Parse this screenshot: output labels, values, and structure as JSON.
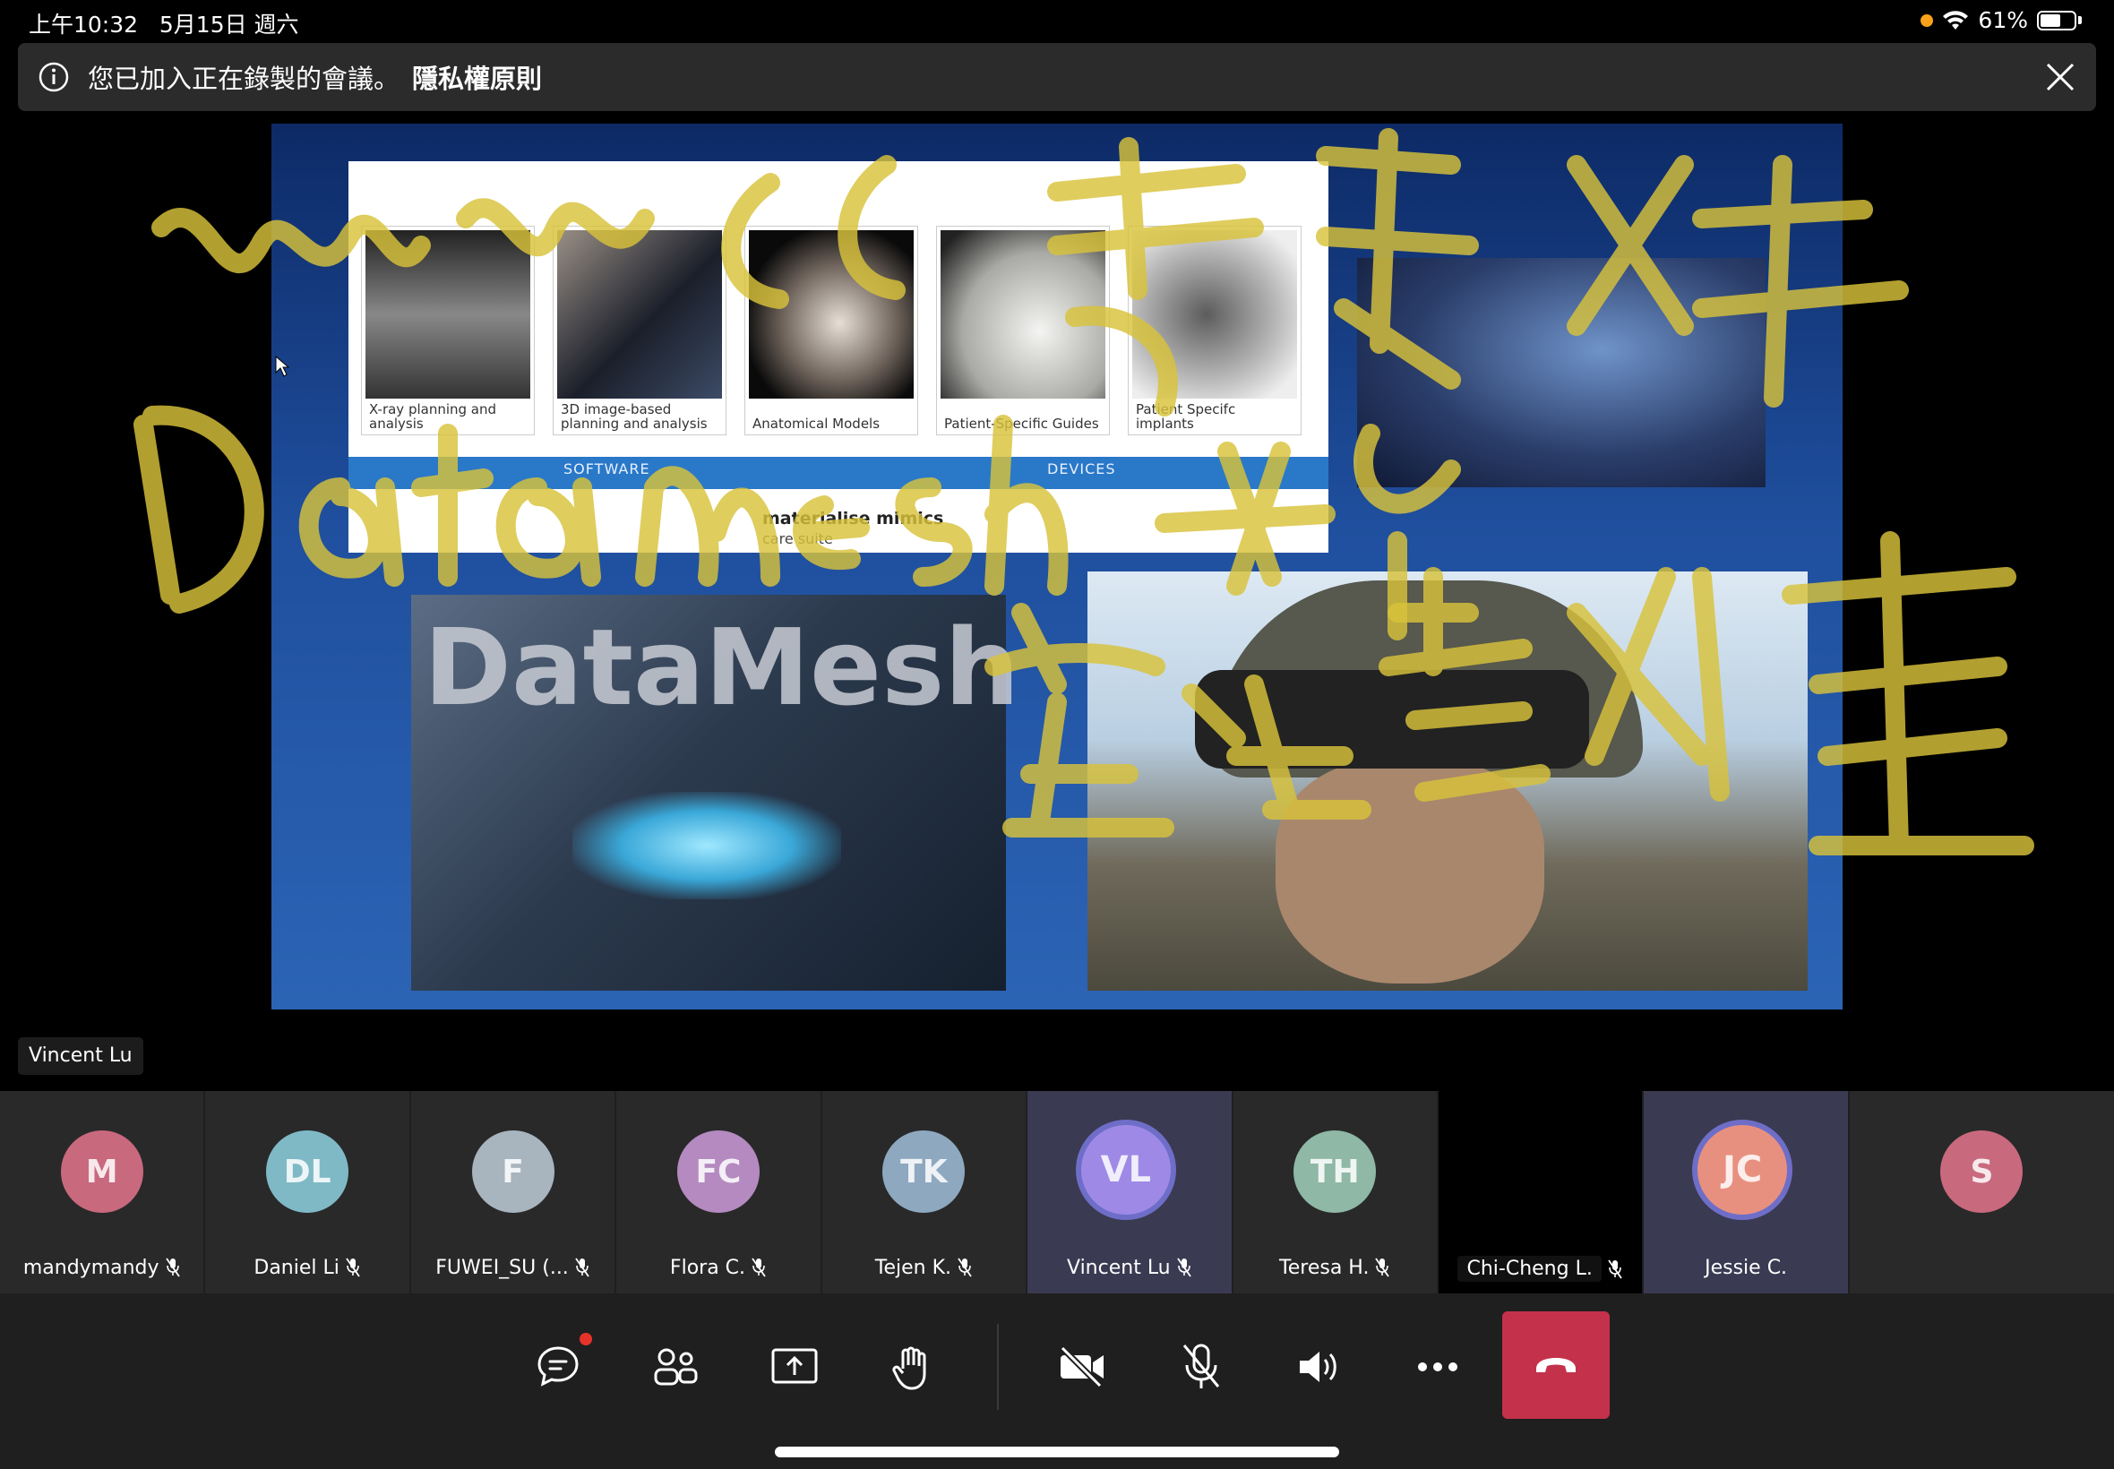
{
  "status_bar": {
    "time": "上午10:32",
    "date": "5月15日 週六",
    "battery": "61%",
    "battery_level": 0.61
  },
  "banner": {
    "text": "您已加入正在錄製的會議。",
    "link": "隱私權原則"
  },
  "slide": {
    "tiles": [
      "X-ray planning and analysis",
      "3D image-based planning and analysis",
      "Anatomical Models",
      "Patient-Specific Guides",
      "Patient Specifc implants"
    ],
    "stripe_left": "SOFTWARE",
    "stripe_right": "DEVICES",
    "brand": "materialise mimics",
    "brand_sub": "care suite",
    "datamesh_word": "DataMesh"
  },
  "speaker_label": "Vincent Lu",
  "participants": [
    {
      "initials": "M",
      "name": "mandymandy",
      "color": "#c9697e",
      "muted": true
    },
    {
      "initials": "DL",
      "name": "Daniel Li",
      "color": "#7fb9c6",
      "muted": true
    },
    {
      "initials": "F",
      "name": "FUWEI_SU (...",
      "color": "#a8b4be",
      "muted": true
    },
    {
      "initials": "FC",
      "name": "Flora C.",
      "color": "#b48ac0",
      "muted": true
    },
    {
      "initials": "TK",
      "name": "Tejen K.",
      "color": "#8ea8bf",
      "muted": true
    },
    {
      "initials": "VL",
      "name": "Vincent Lu",
      "color": "#9e8ae6",
      "muted": true
    },
    {
      "initials": "TH",
      "name": "Teresa H.",
      "color": "#8fb8a6",
      "muted": true
    },
    {
      "initials": "",
      "name": "Chi-Cheng L.",
      "color": "#000000",
      "muted": true
    },
    {
      "initials": "JC",
      "name": "Jessie C.",
      "color": "#e8907f",
      "muted": false
    },
    {
      "initials": "S",
      "name": "",
      "color": "#c9697e",
      "muted": false
    }
  ],
  "toolbar": {
    "icons": [
      "chat-icon",
      "participants-icon",
      "share-screen-icon",
      "raise-hand-icon",
      "camera-off-icon",
      "mic-off-icon",
      "speaker-icon",
      "more-icon",
      "hang-up-icon"
    ],
    "hangup_color": "#c4314b"
  }
}
